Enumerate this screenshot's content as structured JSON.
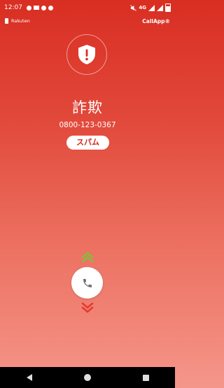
{
  "status_bar": {
    "time": "12:07",
    "network": "4G"
  },
  "header": {
    "carrier": "Rakuten",
    "app_logo": "CallApp®"
  },
  "caller": {
    "name": "詐欺",
    "number": "0800-123-0367",
    "tag": "スパム"
  },
  "colors": {
    "bg_top": "#d92e22",
    "bg_bottom": "#f5968a",
    "accept": "#7cc23a",
    "decline": "#e53b2e"
  },
  "icons": [
    "shield-alert-icon",
    "phone-icon",
    "chevron-up-icon",
    "chevron-down-icon",
    "back-icon",
    "home-icon",
    "recents-icon"
  ]
}
